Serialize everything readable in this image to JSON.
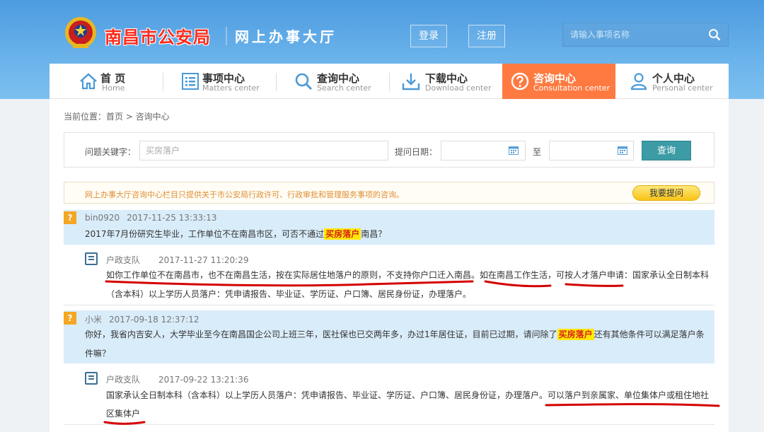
{
  "header": {
    "site_title": "南昌市公安局",
    "site_subtitle": "网上办事大厅",
    "login_label": "登录",
    "register_label": "注册",
    "search_placeholder": "请输入事项名称"
  },
  "nav": [
    {
      "cn": "首 页",
      "en": "Home",
      "icon": "home-icon",
      "active": false
    },
    {
      "cn": "事项中心",
      "en": "Matters center",
      "icon": "list-icon",
      "active": false
    },
    {
      "cn": "查询中心",
      "en": "Search center",
      "icon": "search-icon",
      "active": false
    },
    {
      "cn": "下载中心",
      "en": "Download center",
      "icon": "download-icon",
      "active": false
    },
    {
      "cn": "咨询中心",
      "en": "Consultation center",
      "icon": "question-icon",
      "active": true
    },
    {
      "cn": "个人中心",
      "en": "Personal center",
      "icon": "user-icon",
      "active": false
    }
  ],
  "breadcrumb": "当前位置：首页 > 咨询中心",
  "filter": {
    "keyword_label": "问题关键字：",
    "keyword_placeholder": "买房落户",
    "date_label": "提问日期：",
    "to_label": "至",
    "query_label": "查询"
  },
  "notice": {
    "text": "网上办事大厅咨询中心栏目只提供关于市公安局行政许可、行政审批和管理服务事项的咨询。",
    "ask_label": "我要提问"
  },
  "qa": [
    {
      "q_icon": "?",
      "user": "bin0920",
      "time": "2017-11-25 13:33:13",
      "q_before": "2017年7月份研究生毕业，工作单位不在南昌市区，可否不通过",
      "q_highlight": "买房落户",
      "q_after": "南昌？",
      "a_dept": "户政支队",
      "a_time": "2017-11-27 11:20:29",
      "a_line1": "如你工作单位不在南昌市，也不在南昌生活，按在实际居住地落户的原则，不支持你户口迁入南昌。如在南昌工作生活，可按人才落户申请：国家承认全日制本科",
      "a_line2": "（含本科）以上学历人员落户：凭申请报告、毕业证、学历证、户口簿、居民身份证，办理落户。"
    },
    {
      "q_icon": "?",
      "user": "小米",
      "time": "2017-09-18 12:37:12",
      "q_before": "你好，我省内吉安人，大学毕业至今在南昌国企公司上班三年，医社保也已交两年多，办过1年居住证，目前已过期，请问除了",
      "q_highlight": "买房落户",
      "q_after": "还有其他条件可以满足落户条",
      "q_line2": "件嘛？",
      "a_dept": "户政支队",
      "a_time": "2017-09-22 13:21:36",
      "a_line1": "国家承认全日制本科（含本科）以上学历人员落户：凭申请报告、毕业证、学历证、户口簿、居民身份证，办理落户。可以落户到亲属家、单位集体户或租住地社",
      "a_line2": "区集体户"
    }
  ],
  "colors": {
    "header_blue": "#5fa8e6",
    "active_tab": "#ff7a41",
    "question_bg": "#d9ecfa",
    "highlight": "#ffe800",
    "query_btn": "#3c9ba5",
    "annotation_red": "#d40000"
  }
}
